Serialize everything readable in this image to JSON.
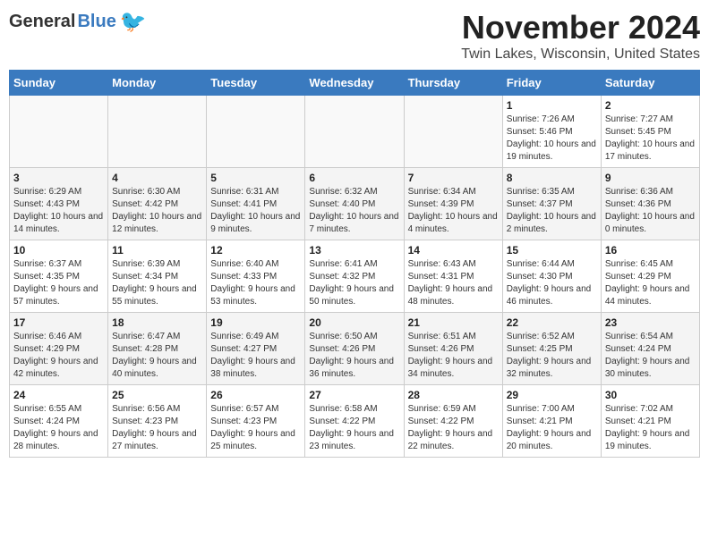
{
  "header": {
    "logo_general": "General",
    "logo_blue": "Blue",
    "month_title": "November 2024",
    "location": "Twin Lakes, Wisconsin, United States"
  },
  "weekdays": [
    "Sunday",
    "Monday",
    "Tuesday",
    "Wednesday",
    "Thursday",
    "Friday",
    "Saturday"
  ],
  "weeks": [
    [
      {
        "day": "",
        "info": ""
      },
      {
        "day": "",
        "info": ""
      },
      {
        "day": "",
        "info": ""
      },
      {
        "day": "",
        "info": ""
      },
      {
        "day": "",
        "info": ""
      },
      {
        "day": "1",
        "info": "Sunrise: 7:26 AM\nSunset: 5:46 PM\nDaylight: 10 hours and 19 minutes."
      },
      {
        "day": "2",
        "info": "Sunrise: 7:27 AM\nSunset: 5:45 PM\nDaylight: 10 hours and 17 minutes."
      }
    ],
    [
      {
        "day": "3",
        "info": "Sunrise: 6:29 AM\nSunset: 4:43 PM\nDaylight: 10 hours and 14 minutes."
      },
      {
        "day": "4",
        "info": "Sunrise: 6:30 AM\nSunset: 4:42 PM\nDaylight: 10 hours and 12 minutes."
      },
      {
        "day": "5",
        "info": "Sunrise: 6:31 AM\nSunset: 4:41 PM\nDaylight: 10 hours and 9 minutes."
      },
      {
        "day": "6",
        "info": "Sunrise: 6:32 AM\nSunset: 4:40 PM\nDaylight: 10 hours and 7 minutes."
      },
      {
        "day": "7",
        "info": "Sunrise: 6:34 AM\nSunset: 4:39 PM\nDaylight: 10 hours and 4 minutes."
      },
      {
        "day": "8",
        "info": "Sunrise: 6:35 AM\nSunset: 4:37 PM\nDaylight: 10 hours and 2 minutes."
      },
      {
        "day": "9",
        "info": "Sunrise: 6:36 AM\nSunset: 4:36 PM\nDaylight: 10 hours and 0 minutes."
      }
    ],
    [
      {
        "day": "10",
        "info": "Sunrise: 6:37 AM\nSunset: 4:35 PM\nDaylight: 9 hours and 57 minutes."
      },
      {
        "day": "11",
        "info": "Sunrise: 6:39 AM\nSunset: 4:34 PM\nDaylight: 9 hours and 55 minutes."
      },
      {
        "day": "12",
        "info": "Sunrise: 6:40 AM\nSunset: 4:33 PM\nDaylight: 9 hours and 53 minutes."
      },
      {
        "day": "13",
        "info": "Sunrise: 6:41 AM\nSunset: 4:32 PM\nDaylight: 9 hours and 50 minutes."
      },
      {
        "day": "14",
        "info": "Sunrise: 6:43 AM\nSunset: 4:31 PM\nDaylight: 9 hours and 48 minutes."
      },
      {
        "day": "15",
        "info": "Sunrise: 6:44 AM\nSunset: 4:30 PM\nDaylight: 9 hours and 46 minutes."
      },
      {
        "day": "16",
        "info": "Sunrise: 6:45 AM\nSunset: 4:29 PM\nDaylight: 9 hours and 44 minutes."
      }
    ],
    [
      {
        "day": "17",
        "info": "Sunrise: 6:46 AM\nSunset: 4:29 PM\nDaylight: 9 hours and 42 minutes."
      },
      {
        "day": "18",
        "info": "Sunrise: 6:47 AM\nSunset: 4:28 PM\nDaylight: 9 hours and 40 minutes."
      },
      {
        "day": "19",
        "info": "Sunrise: 6:49 AM\nSunset: 4:27 PM\nDaylight: 9 hours and 38 minutes."
      },
      {
        "day": "20",
        "info": "Sunrise: 6:50 AM\nSunset: 4:26 PM\nDaylight: 9 hours and 36 minutes."
      },
      {
        "day": "21",
        "info": "Sunrise: 6:51 AM\nSunset: 4:26 PM\nDaylight: 9 hours and 34 minutes."
      },
      {
        "day": "22",
        "info": "Sunrise: 6:52 AM\nSunset: 4:25 PM\nDaylight: 9 hours and 32 minutes."
      },
      {
        "day": "23",
        "info": "Sunrise: 6:54 AM\nSunset: 4:24 PM\nDaylight: 9 hours and 30 minutes."
      }
    ],
    [
      {
        "day": "24",
        "info": "Sunrise: 6:55 AM\nSunset: 4:24 PM\nDaylight: 9 hours and 28 minutes."
      },
      {
        "day": "25",
        "info": "Sunrise: 6:56 AM\nSunset: 4:23 PM\nDaylight: 9 hours and 27 minutes."
      },
      {
        "day": "26",
        "info": "Sunrise: 6:57 AM\nSunset: 4:23 PM\nDaylight: 9 hours and 25 minutes."
      },
      {
        "day": "27",
        "info": "Sunrise: 6:58 AM\nSunset: 4:22 PM\nDaylight: 9 hours and 23 minutes."
      },
      {
        "day": "28",
        "info": "Sunrise: 6:59 AM\nSunset: 4:22 PM\nDaylight: 9 hours and 22 minutes."
      },
      {
        "day": "29",
        "info": "Sunrise: 7:00 AM\nSunset: 4:21 PM\nDaylight: 9 hours and 20 minutes."
      },
      {
        "day": "30",
        "info": "Sunrise: 7:02 AM\nSunset: 4:21 PM\nDaylight: 9 hours and 19 minutes."
      }
    ]
  ]
}
